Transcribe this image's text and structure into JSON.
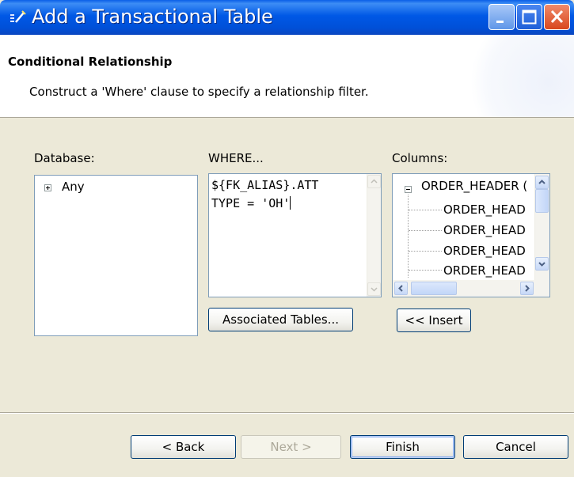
{
  "window": {
    "title": "Add a Transactional Table"
  },
  "header": {
    "title": "Conditional Relationship",
    "description": "Construct a 'Where' clause to specify a relationship filter."
  },
  "database": {
    "label": "Database:",
    "items": [
      {
        "label": "Any",
        "expanded": false
      }
    ]
  },
  "where": {
    "label": "WHERE...",
    "lines": [
      "${FK_ALIAS}.ATT",
      "TYPE = 'OH'"
    ]
  },
  "columns": {
    "label": "Columns:",
    "root": "ORDER_HEADER (",
    "children": [
      "ORDER_HEAD",
      "ORDER_HEAD",
      "ORDER_HEAD",
      "ORDER_HEAD"
    ]
  },
  "actions": {
    "associated_tables": "Associated Tables...",
    "insert": "<< Insert"
  },
  "footer": {
    "back": "< Back",
    "next": "Next >",
    "finish": "Finish",
    "cancel": "Cancel"
  },
  "colors": {
    "titlebar": "#0058e6",
    "dialog_bg": "#ece9d8",
    "field_border": "#7f9db9"
  }
}
